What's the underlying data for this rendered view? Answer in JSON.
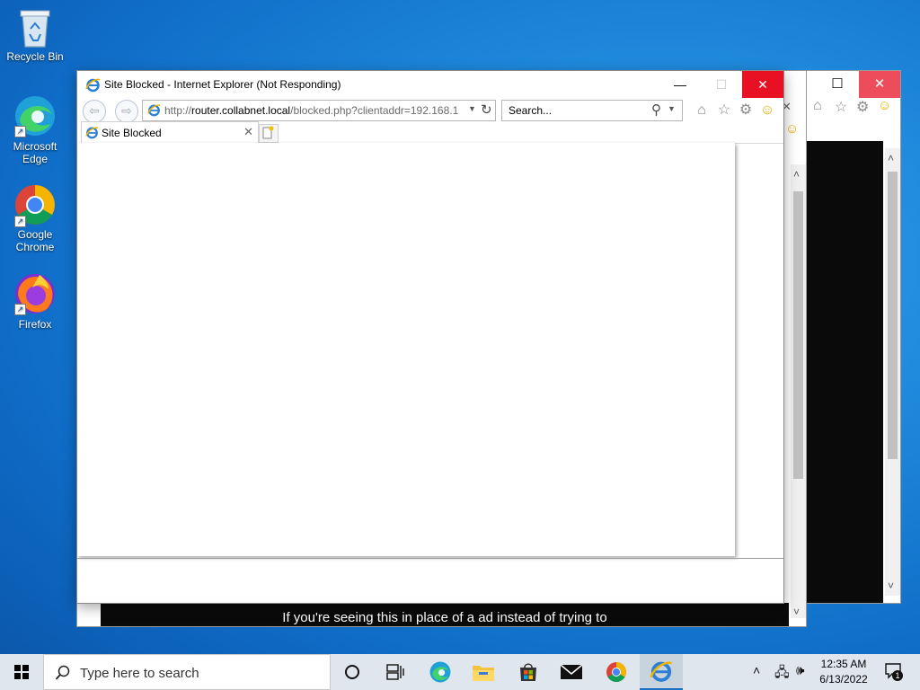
{
  "desktop": {
    "icons": [
      {
        "label": "Recycle Bin",
        "icon": "recycle-bin-icon"
      },
      {
        "label": "Microsoft Edge",
        "icon": "edge-icon"
      },
      {
        "label": "Google Chrome",
        "icon": "chrome-icon"
      },
      {
        "label": "Firefox",
        "icon": "firefox-icon"
      }
    ]
  },
  "ie_window": {
    "title": "Site Blocked - Internet Explorer (Not Responding)",
    "address_host": "router.collabnet.local",
    "address_prefix": "http://",
    "address_path": "/blocked.php?clientaddr=192.168.1",
    "search_placeholder": "Search...",
    "tab_title": "Site Blocked",
    "close_color": "#e81123"
  },
  "background_window": {
    "partial_text": "If you're seeing this in place of a ad instead of trying to"
  },
  "taskbar": {
    "search_placeholder": "Type here to search",
    "time": "12:35 AM",
    "date": "6/13/2022",
    "notification_count": "1",
    "pinned": [
      "task-view-icon",
      "edge-icon",
      "file-explorer-icon",
      "store-icon",
      "mail-icon",
      "chrome-icon",
      "internet-explorer-icon"
    ]
  },
  "colors": {
    "accent": "#1a6fc4",
    "taskbar": "#dfe6ed"
  }
}
